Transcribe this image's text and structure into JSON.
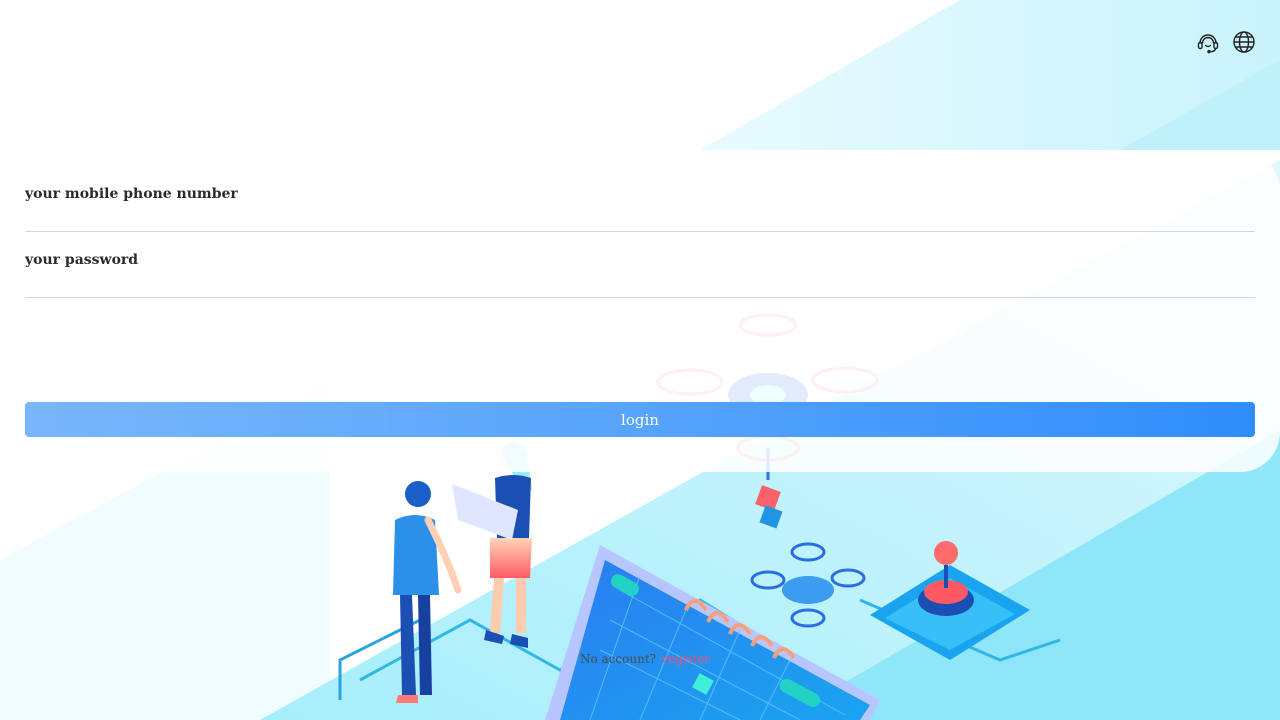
{
  "header": {
    "icons": [
      {
        "name": "customer-service-icon"
      },
      {
        "name": "globe-icon"
      }
    ]
  },
  "login_form": {
    "phone_placeholder": "your mobile phone number",
    "password_placeholder": "your password",
    "login_label": "login"
  },
  "footer": {
    "question": "No account?",
    "register_label": "register"
  },
  "colors": {
    "button_start": "#79b6fb",
    "button_end": "#2f8dfb",
    "link": "#ff4b6e",
    "background_accent": "#7ee3f7"
  }
}
